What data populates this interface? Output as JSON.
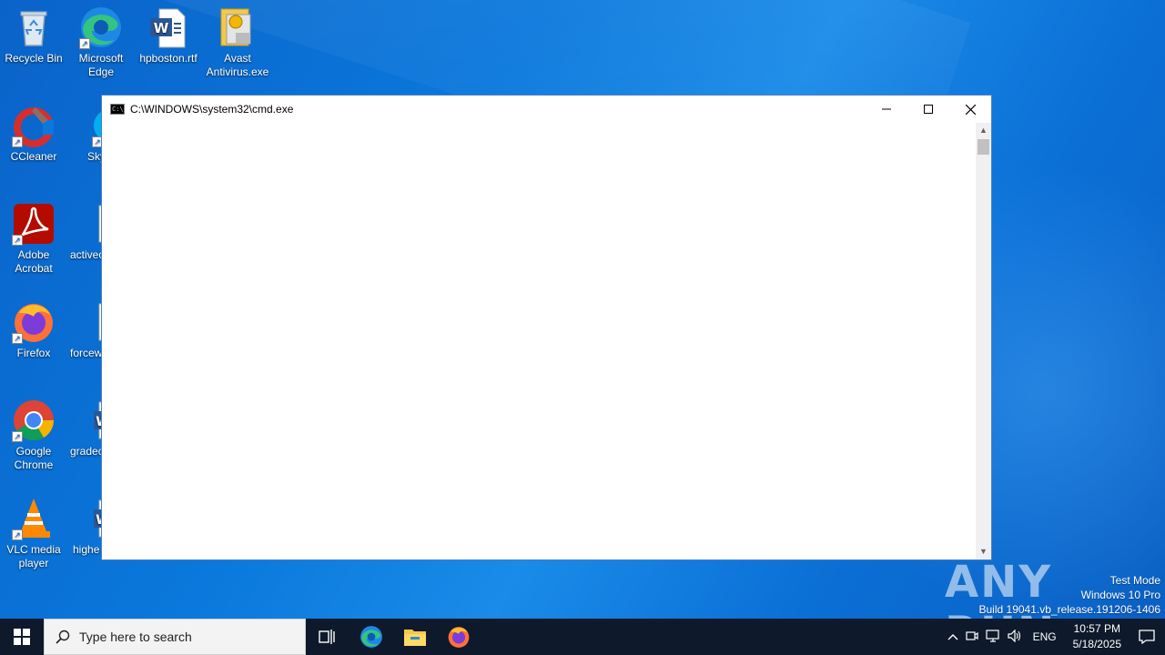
{
  "desktop": {
    "icons": [
      {
        "label": "Recycle Bin",
        "icon": "recycle-bin-icon"
      },
      {
        "label": "Microsoft Edge",
        "icon": "edge-icon"
      },
      {
        "label": "hpboston.rtf",
        "icon": "word-document-icon"
      },
      {
        "label": "Avast Antivirus.exe",
        "icon": "folder-exe-icon"
      },
      {
        "label": "CCleaner",
        "icon": "ccleaner-icon"
      },
      {
        "label": "Sky",
        "icon": "skype-icon"
      },
      {
        "label": "Adobe Acrobat",
        "icon": "acrobat-icon"
      },
      {
        "label": "activec",
        "icon": "image-file-icon"
      },
      {
        "label": "Firefox",
        "icon": "firefox-icon"
      },
      {
        "label": "forcew",
        "icon": "image-file-icon"
      },
      {
        "label": "Google Chrome",
        "icon": "chrome-icon"
      },
      {
        "label": "gradec",
        "icon": "word-document-icon"
      },
      {
        "label": "VLC media player",
        "icon": "vlc-icon"
      },
      {
        "label": "highe",
        "icon": "word-document-icon"
      }
    ]
  },
  "cmd_window": {
    "title": "C:\\WINDOWS\\system32\\cmd.exe",
    "content": ""
  },
  "watermark": {
    "brand": "ANY RUN",
    "mode": "Test Mode",
    "edition": "Windows 10 Pro",
    "build": "Build 19041.vb_release.191206-1406"
  },
  "taskbar": {
    "search_placeholder": "Type here to search",
    "apps": [
      "task-view-icon",
      "edge-icon",
      "file-explorer-icon",
      "firefox-icon"
    ],
    "language": "ENG",
    "time": "10:57 PM",
    "date": "5/18/2025"
  },
  "colors": {
    "desktop_blue": "#0a78dc",
    "taskbar": "#0e1a2b",
    "window_border": "#4a7fc1"
  }
}
